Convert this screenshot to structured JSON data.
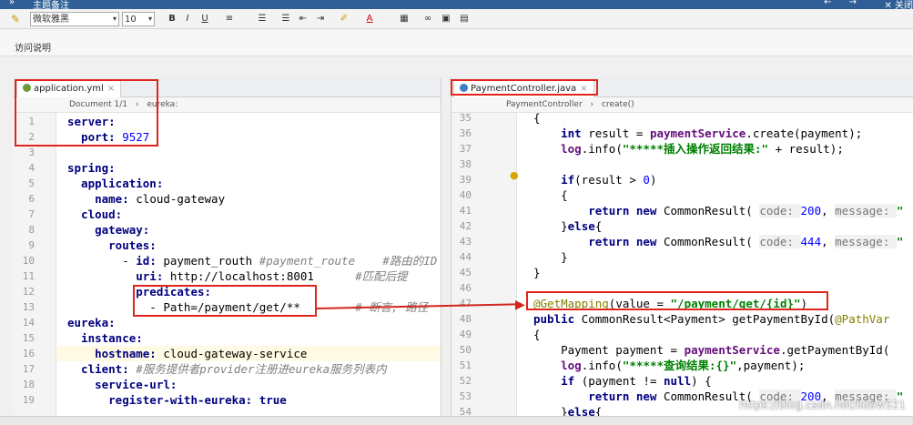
{
  "window": {
    "nav_icon": "»",
    "title": "主题备注",
    "nav_arrows": "← →",
    "close_label": "✕ 关闭"
  },
  "toolbar": {
    "font_family": "微软雅黑",
    "font_size": "10",
    "bold": "B",
    "italic": "I",
    "underline": "U"
  },
  "header": {
    "title": "访问说明"
  },
  "left_editor": {
    "tab_label": "application.yml",
    "breadcrumb": [
      "Document 1/1",
      "eureka:"
    ],
    "lines": [
      {
        "n": "1",
        "segs": [
          {
            "c": "key",
            "t": "server:"
          }
        ]
      },
      {
        "n": "2",
        "segs": [
          {
            "c": "key",
            "t": "  port: "
          },
          {
            "c": "num",
            "t": "9527"
          }
        ]
      },
      {
        "n": "3",
        "segs": []
      },
      {
        "n": "4",
        "segs": [
          {
            "c": "key",
            "t": "spring:"
          }
        ]
      },
      {
        "n": "5",
        "segs": [
          {
            "c": "key",
            "t": "  application:"
          }
        ]
      },
      {
        "n": "6",
        "segs": [
          {
            "c": "key",
            "t": "    name: "
          },
          {
            "c": "val",
            "t": "cloud-gateway"
          }
        ]
      },
      {
        "n": "7",
        "segs": [
          {
            "c": "key",
            "t": "  cloud:"
          }
        ]
      },
      {
        "n": "8",
        "segs": [
          {
            "c": "key",
            "t": "    gateway:"
          }
        ]
      },
      {
        "n": "9",
        "segs": [
          {
            "c": "key",
            "t": "      routes:"
          }
        ]
      },
      {
        "n": "10",
        "segs": [
          {
            "c": "val",
            "t": "        - "
          },
          {
            "c": "key",
            "t": "id: "
          },
          {
            "c": "val",
            "t": "payment_routh "
          },
          {
            "c": "cmt",
            "t": "#payment_route    #路由的ID"
          }
        ]
      },
      {
        "n": "11",
        "segs": [
          {
            "c": "key",
            "t": "          uri: "
          },
          {
            "c": "val",
            "t": "http://localhost:8001      "
          },
          {
            "c": "cmt",
            "t": "#匹配后提"
          }
        ]
      },
      {
        "n": "12",
        "segs": [
          {
            "c": "key",
            "t": "          predicates:"
          }
        ]
      },
      {
        "n": "13",
        "segs": [
          {
            "c": "val",
            "t": "            - Path=/payment/get/**        "
          },
          {
            "c": "cmt",
            "t": "# 断言, 路径"
          }
        ]
      },
      {
        "n": "14",
        "segs": [
          {
            "c": "key",
            "t": "eureka:"
          }
        ]
      },
      {
        "n": "15",
        "segs": [
          {
            "c": "key",
            "t": "  instance:"
          }
        ]
      },
      {
        "n": "16",
        "segs": [
          {
            "c": "key",
            "t": "    hostname: "
          },
          {
            "c": "val",
            "t": "cloud-gateway-service"
          }
        ]
      },
      {
        "n": "17",
        "segs": [
          {
            "c": "key",
            "t": "  client: "
          },
          {
            "c": "cmt",
            "t": "#服务提供者provider注册进eureka服务列表内"
          }
        ]
      },
      {
        "n": "18",
        "segs": [
          {
            "c": "key",
            "t": "    service-url:"
          }
        ]
      },
      {
        "n": "19",
        "segs": [
          {
            "c": "key",
            "t": "      register-with-eureka: "
          },
          {
            "c": "kw",
            "t": "true"
          }
        ]
      }
    ]
  },
  "right_editor": {
    "tab_label": "PaymentController.java",
    "breadcrumb": [
      "PaymentController",
      "create()"
    ],
    "lines": [
      {
        "n": "35",
        "segs": [
          {
            "c": "val",
            "t": "{"
          }
        ]
      },
      {
        "n": "36",
        "segs": [
          {
            "c": "kw",
            "t": "    int "
          },
          {
            "c": "val",
            "t": "result = "
          },
          {
            "c": "fld",
            "t": "paymentService"
          },
          {
            "c": "val",
            "t": ".create(payment);"
          }
        ]
      },
      {
        "n": "37",
        "segs": [
          {
            "c": "fld",
            "t": "    log"
          },
          {
            "c": "val",
            "t": ".info("
          },
          {
            "c": "str",
            "t": "\"*****插入操作返回结果:\""
          },
          {
            "c": "val",
            "t": " + result);"
          }
        ]
      },
      {
        "n": "38",
        "segs": []
      },
      {
        "n": "39",
        "segs": [
          {
            "c": "kw",
            "t": "    if"
          },
          {
            "c": "val",
            "t": "(result > "
          },
          {
            "c": "num",
            "t": "0"
          },
          {
            "c": "val",
            "t": ")"
          }
        ]
      },
      {
        "n": "40",
        "segs": [
          {
            "c": "val",
            "t": "    {"
          }
        ]
      },
      {
        "n": "41",
        "segs": [
          {
            "c": "kw",
            "t": "        return new "
          },
          {
            "c": "val",
            "t": "CommonResult( "
          },
          {
            "c": "hint",
            "t": "code: "
          },
          {
            "c": "num",
            "t": "200"
          },
          {
            "c": "val",
            "t": ", "
          },
          {
            "c": "hint",
            "t": "message: "
          },
          {
            "c": "str",
            "t": "\""
          }
        ]
      },
      {
        "n": "42",
        "segs": [
          {
            "c": "val",
            "t": "    }"
          },
          {
            "c": "kw",
            "t": "else"
          },
          {
            "c": "val",
            "t": "{"
          }
        ]
      },
      {
        "n": "43",
        "segs": [
          {
            "c": "kw",
            "t": "        return new "
          },
          {
            "c": "val",
            "t": "CommonResult( "
          },
          {
            "c": "hint",
            "t": "code: "
          },
          {
            "c": "num",
            "t": "444"
          },
          {
            "c": "val",
            "t": ", "
          },
          {
            "c": "hint",
            "t": "message: "
          },
          {
            "c": "str",
            "t": "\""
          }
        ]
      },
      {
        "n": "44",
        "segs": [
          {
            "c": "val",
            "t": "    }"
          }
        ]
      },
      {
        "n": "45",
        "segs": [
          {
            "c": "val",
            "t": "}"
          }
        ]
      },
      {
        "n": "46",
        "segs": []
      },
      {
        "n": "47",
        "segs": [
          {
            "c": "ann",
            "t": "@GetMapping"
          },
          {
            "c": "val",
            "t": "(value = "
          },
          {
            "c": "str",
            "t": "\"/payment/get/{id}\""
          },
          {
            "c": "val",
            "t": ")"
          }
        ]
      },
      {
        "n": "48",
        "segs": [
          {
            "c": "kw",
            "t": "public "
          },
          {
            "c": "val",
            "t": "CommonResult<Payment> getPaymentById("
          },
          {
            "c": "ann",
            "t": "@PathVar"
          }
        ]
      },
      {
        "n": "49",
        "segs": [
          {
            "c": "val",
            "t": "{"
          }
        ]
      },
      {
        "n": "50",
        "segs": [
          {
            "c": "val",
            "t": "    Payment payment = "
          },
          {
            "c": "fld",
            "t": "paymentService"
          },
          {
            "c": "val",
            "t": ".getPaymentById("
          }
        ]
      },
      {
        "n": "51",
        "segs": [
          {
            "c": "fld",
            "t": "    log"
          },
          {
            "c": "val",
            "t": ".info("
          },
          {
            "c": "str",
            "t": "\"*****查询结果:{}\""
          },
          {
            "c": "val",
            "t": ",payment);"
          }
        ]
      },
      {
        "n": "52",
        "segs": [
          {
            "c": "kw",
            "t": "    if "
          },
          {
            "c": "val",
            "t": "(payment != "
          },
          {
            "c": "kw",
            "t": "null"
          },
          {
            "c": "val",
            "t": ") {"
          }
        ]
      },
      {
        "n": "53",
        "segs": [
          {
            "c": "kw",
            "t": "        return new "
          },
          {
            "c": "val",
            "t": "CommonResult( "
          },
          {
            "c": "hint",
            "t": "code: "
          },
          {
            "c": "num",
            "t": "200"
          },
          {
            "c": "val",
            "t": ", "
          },
          {
            "c": "hint",
            "t": "message: "
          },
          {
            "c": "str",
            "t": "\""
          }
        ]
      },
      {
        "n": "54",
        "segs": [
          {
            "c": "val",
            "t": "    }"
          },
          {
            "c": "kw",
            "t": "else"
          },
          {
            "c": "val",
            "t": "{"
          }
        ]
      }
    ]
  },
  "watermark": "https://blog.csdn.net/lidew521"
}
